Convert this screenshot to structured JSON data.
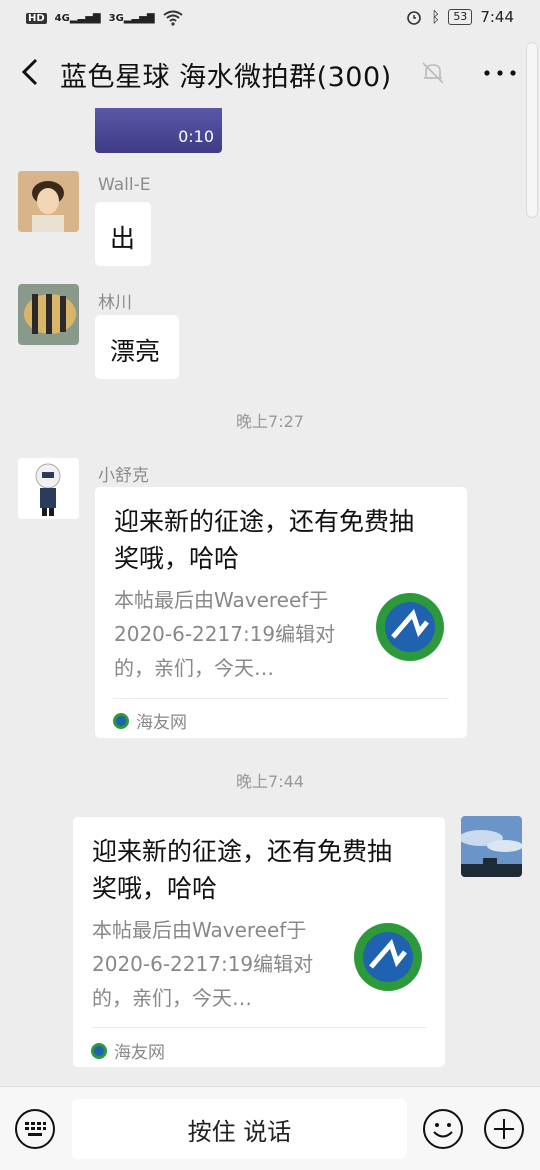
{
  "status": {
    "left_label": "HD 4G 3G",
    "battery": "53",
    "time": "7:44"
  },
  "header": {
    "back_label": "返回",
    "title": "蓝色星球 海水微拍群(300)"
  },
  "video": {
    "duration": "0:10"
  },
  "messages": [
    {
      "sender": "Wall-E",
      "text": "出"
    },
    {
      "sender": "林川",
      "text": "漂亮"
    }
  ],
  "timestamps": [
    "晚上7:27",
    "晚上7:44"
  ],
  "cards": [
    {
      "sender": "小舒克",
      "title": "迎来新的征途，还有免费抽奖哦，哈哈",
      "desc": "本帖最后由Wavereef于2020-6-2217:19编辑对的，亲们，今天…",
      "source": "海友网"
    },
    {
      "sender": "",
      "title": "迎来新的征途，还有免费抽奖哦，哈哈",
      "desc": "本帖最后由Wavereef于2020-6-2217:19编辑对的，亲们，今天…",
      "source": "海友网"
    }
  ],
  "input": {
    "hold_to_talk": "按住 说话"
  },
  "colors": {
    "background": "#ededed",
    "bubble": "#ffffff",
    "brand_green": "#2c9a3a",
    "brand_blue": "#1f62b0"
  }
}
